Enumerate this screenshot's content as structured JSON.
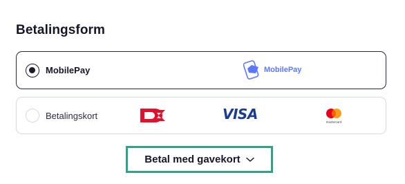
{
  "page": {
    "title": "Betalingsform"
  },
  "options": [
    {
      "label": "MobilePay",
      "selected": true,
      "logo_text": "MobilePay",
      "logo_icon": "mobilepay-icon"
    },
    {
      "label": "Betalingskort",
      "selected": false,
      "logos": [
        "dankort-logo",
        "visa-logo",
        "mastercard-logo"
      ],
      "visa_text": "VISA",
      "mastercard_text": "mastercard"
    }
  ],
  "gift_card": {
    "label": "Betal med gavekort",
    "icon": "chevron-down-icon"
  },
  "colors": {
    "border_selected": "#1f2a3d",
    "border_default": "#d6d9de",
    "mobilepay_blue": "#5a78ff",
    "dankort_red": "#e3102b",
    "visa_blue": "#1a3d8f",
    "highlight_green": "#2fa387"
  }
}
